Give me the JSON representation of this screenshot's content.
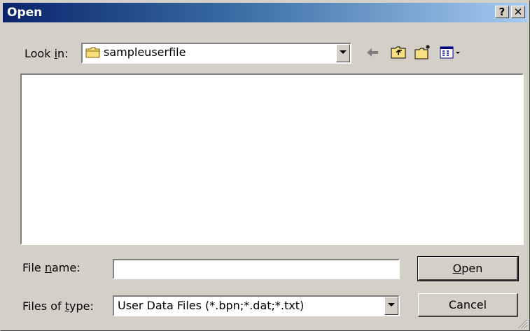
{
  "window": {
    "title": "Open",
    "help_button": "?",
    "close_button": "✕"
  },
  "look_in": {
    "label_pre": "Look ",
    "label_accel": "i",
    "label_post": "n:",
    "value": "sampleuserfile",
    "folder_icon": "folder-icon"
  },
  "toolbar": {
    "icons": [
      "back-arrow-icon",
      "up-one-level-icon",
      "create-new-folder-icon",
      "view-menu-icon"
    ]
  },
  "file_name": {
    "label_pre": "File ",
    "label_accel": "n",
    "label_post": "ame:",
    "value": ""
  },
  "file_type": {
    "label_pre": "Files of ",
    "label_accel": "t",
    "label_post": "ype:",
    "value": "User Data Files (*.bpn;*.dat;*.txt)"
  },
  "buttons": {
    "open_accel": "O",
    "open_rest": "pen",
    "cancel": "Cancel"
  },
  "colors": {
    "titlebar_start": "#0a246a",
    "titlebar_end": "#a6caf0",
    "face": "#d4d0c8"
  }
}
